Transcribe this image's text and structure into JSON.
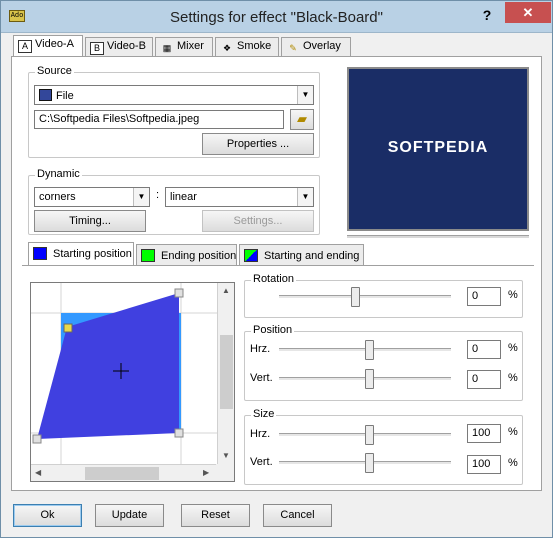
{
  "window": {
    "title": "Settings for effect \"Black-Board\"",
    "app_icon_text": "Ado",
    "help_label": "?",
    "close_label": "✕"
  },
  "tabs": [
    {
      "icon": "A",
      "label": "Video-A"
    },
    {
      "icon": "B",
      "label": "Video-B"
    },
    {
      "icon": "mixer-icon",
      "label": "Mixer"
    },
    {
      "icon": "smoke-icon",
      "label": "Smoke"
    },
    {
      "icon": "overlay-icon",
      "label": "Overlay"
    }
  ],
  "source": {
    "group_label": "Source",
    "type_value": "File",
    "path_value": "C:\\Softpedia Files\\Softpedia.jpeg",
    "properties_label": "Properties ..."
  },
  "dynamic": {
    "group_label": "Dynamic",
    "mode_value": "corners",
    "separator": ":",
    "interp_value": "linear",
    "timing_label": "Timing...",
    "settings_label": "Settings..."
  },
  "preview": {
    "logo_text": "SOFTPEDIA",
    "watermark": "SOFTPEDIA"
  },
  "position_tabs": [
    {
      "label": "Starting position",
      "color": "#0000ff"
    },
    {
      "label": "Ending position",
      "color": "#00ff00"
    },
    {
      "label": "Starting and ending",
      "color": "#0000ff"
    }
  ],
  "rotation": {
    "group_label": "Rotation",
    "value": "0",
    "unit": "%",
    "level": 0.5
  },
  "position": {
    "group_label": "Position",
    "hrz_label": "Hrz.",
    "hrz_value": "0",
    "hrz_unit": "%",
    "hrz_level": 0.5,
    "vert_label": "Vert.",
    "vert_value": "0",
    "vert_unit": "%",
    "vert_level": 0.5
  },
  "size": {
    "group_label": "Size",
    "hrz_label": "Hrz.",
    "hrz_value": "100",
    "hrz_unit": "%",
    "hrz_level": 0.5,
    "vert_label": "Vert.",
    "vert_value": "100",
    "vert_unit": "%",
    "vert_level": 0.5
  },
  "buttons": {
    "ok": "Ok",
    "update": "Update",
    "reset": "Reset",
    "cancel": "Cancel"
  },
  "colors": {
    "shape": "#4040e0",
    "frame": "#3399ff",
    "handle": "#e8d84a",
    "preview_bg": "#1a2d66",
    "close": "#c75050"
  }
}
